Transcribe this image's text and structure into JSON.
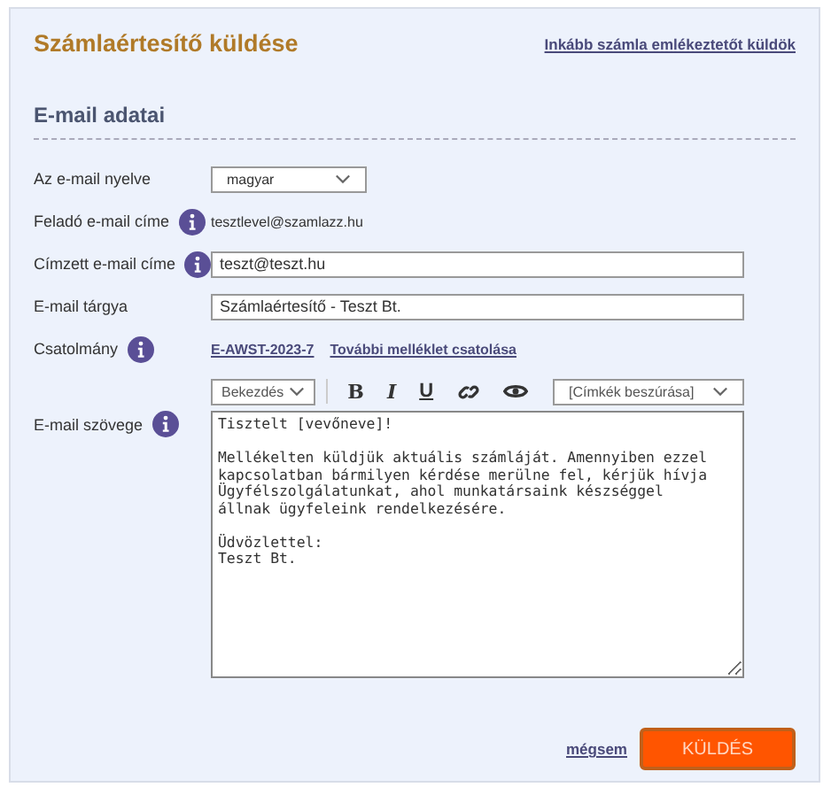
{
  "title": "Számlaértesítő küldése",
  "alt_link": "Inkább számla emlékeztetőt küldök",
  "section_title": "E-mail adatai",
  "fields": [
    {
      "kind": "select",
      "label": "Az e-mail nyelve",
      "info": false,
      "value": "magyar"
    },
    {
      "kind": "text",
      "label": "Feladó e-mail címe",
      "info": true,
      "value": "tesztlevel@szamlazz.hu"
    },
    {
      "kind": "input",
      "label": "Címzett e-mail címe",
      "info": true,
      "value": "teszt@teszt.hu"
    },
    {
      "kind": "input",
      "label": "E-mail tárgya",
      "info": false,
      "value": "Számlaértesítő - Teszt Bt."
    },
    {
      "kind": "links",
      "label": "Csatolmány",
      "info": true,
      "links": [
        "E-AWST-2023-7",
        "További melléklet csatolása"
      ]
    }
  ],
  "editor": {
    "label": "E-mail szövege",
    "info": true,
    "format": "Bekezdés",
    "bold": "B",
    "italic": "I",
    "underline": "U",
    "tags": "[Címkék beszúrása]",
    "body": "Tisztelt [vevőneve]!\n\nMellékelten küldjük aktuális számláját. Amennyiben ezzel kapcsolatban bármilyen kérdése merülne fel, kérjük hívja Ügyfélszolgálatunkat, ahol munkatársaink készséggel állnak ügyfeleink rendelkezésére.\n\nÜdvözlettel:\nTeszt Bt."
  },
  "cancel": "mégsem",
  "send": "KÜLDÉS"
}
